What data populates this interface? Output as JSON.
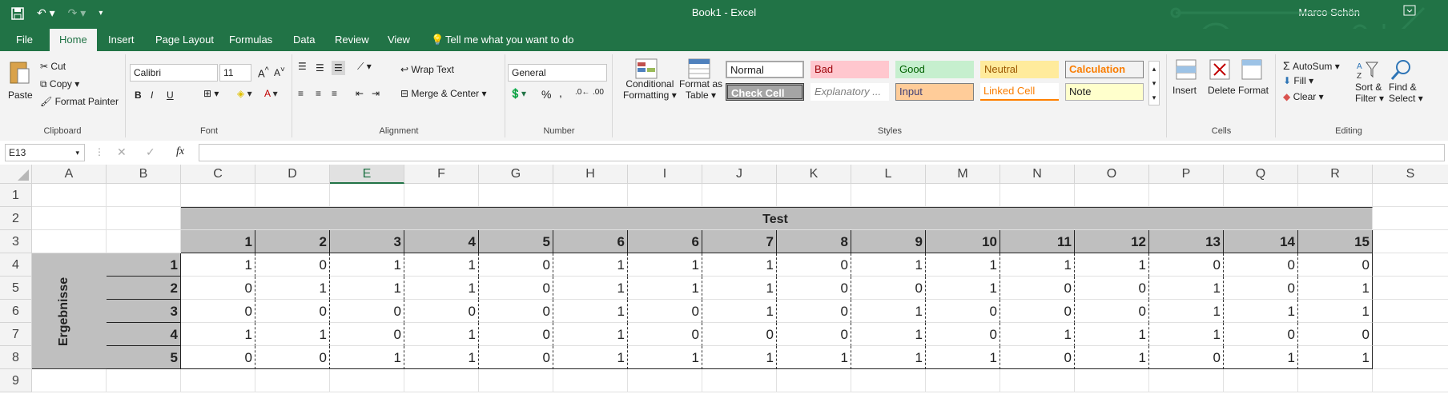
{
  "window": {
    "title": "Book1 - Excel",
    "user": "Marco Schön"
  },
  "tabs": [
    "File",
    "Home",
    "Insert",
    "Page Layout",
    "Formulas",
    "Data",
    "Review",
    "View"
  ],
  "tell_me": "Tell me what you want to do",
  "ribbon": {
    "clipboard": {
      "paste": "Paste",
      "cut": "Cut",
      "copy": "Copy",
      "format_painter": "Format Painter",
      "label": "Clipboard"
    },
    "font": {
      "name": "Calibri",
      "size": "11",
      "bold": "B",
      "italic": "I",
      "underline": "U",
      "label": "Font"
    },
    "alignment": {
      "wrap": "Wrap Text",
      "merge": "Merge & Center",
      "label": "Alignment"
    },
    "number": {
      "format": "General",
      "percent": "%",
      "comma": ",",
      "label": "Number"
    },
    "styles": {
      "conditional": "Conditional",
      "conditional2": "Formatting",
      "format_as": "Format as",
      "format_as2": "Table",
      "normal": "Normal",
      "bad": "Bad",
      "good": "Good",
      "neutral": "Neutral",
      "calculation": "Calculation",
      "check": "Check Cell",
      "explanatory": "Explanatory ...",
      "input": "Input",
      "linked": "Linked Cell",
      "note": "Note",
      "label": "Styles"
    },
    "cells": {
      "insert": "Insert",
      "delete": "Delete",
      "format": "Format",
      "label": "Cells"
    },
    "editing": {
      "autosum": "AutoSum",
      "fill": "Fill",
      "clear": "Clear",
      "sort": "Sort &",
      "sort2": "Filter",
      "find": "Find &",
      "find2": "Select",
      "label": "Editing"
    }
  },
  "formula_bar": {
    "name_box": "E13",
    "fx": "fx",
    "value": ""
  },
  "columns": [
    "A",
    "B",
    "C",
    "D",
    "E",
    "F",
    "G",
    "H",
    "I",
    "J",
    "K",
    "L",
    "M",
    "N",
    "O",
    "P",
    "Q",
    "R",
    "S"
  ],
  "rows": [
    "1",
    "2",
    "3",
    "4",
    "5",
    "6",
    "7",
    "8",
    "9"
  ],
  "sheet": {
    "header_title": "Test",
    "side_title": "Ergebnisse",
    "test_numbers": [
      "1",
      "2",
      "3",
      "4",
      "5",
      "6",
      "6",
      "7",
      "8",
      "9",
      "10",
      "11",
      "12",
      "13",
      "14",
      "15"
    ],
    "row_labels": [
      "1",
      "2",
      "3",
      "4",
      "5"
    ],
    "values": [
      [
        "1",
        "0",
        "1",
        "1",
        "0",
        "1",
        "1",
        "1",
        "0",
        "1",
        "1",
        "1",
        "1",
        "0",
        "0",
        "0"
      ],
      [
        "0",
        "1",
        "1",
        "1",
        "0",
        "1",
        "1",
        "1",
        "0",
        "0",
        "1",
        "0",
        "0",
        "1",
        "0",
        "1"
      ],
      [
        "0",
        "0",
        "0",
        "0",
        "0",
        "1",
        "0",
        "1",
        "0",
        "1",
        "0",
        "0",
        "0",
        "1",
        "1",
        "1"
      ],
      [
        "1",
        "1",
        "0",
        "1",
        "0",
        "1",
        "0",
        "0",
        "0",
        "1",
        "0",
        "1",
        "1",
        "1",
        "0",
        "0"
      ],
      [
        "0",
        "0",
        "1",
        "1",
        "0",
        "1",
        "1",
        "1",
        "1",
        "1",
        "1",
        "0",
        "1",
        "0",
        "1",
        "1"
      ]
    ]
  }
}
